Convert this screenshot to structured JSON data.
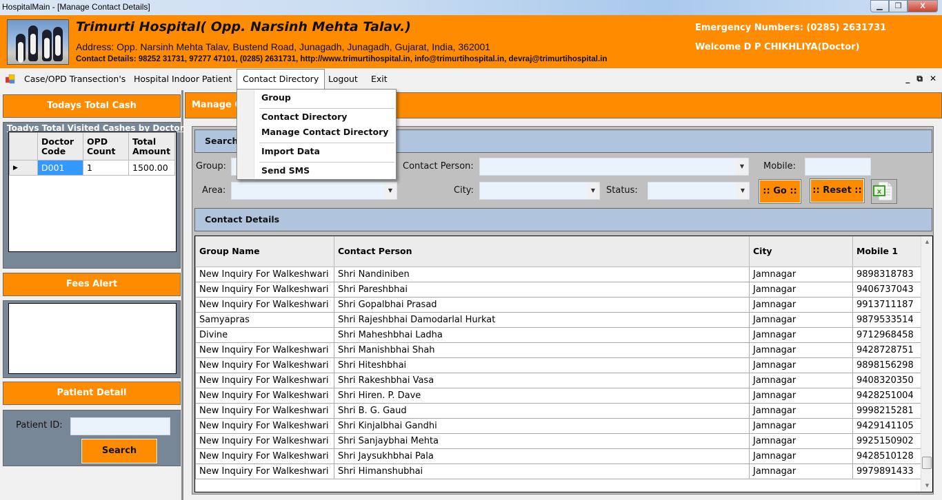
{
  "window": {
    "title": "HospitalMain - [Manage Contact Details]",
    "controls": {
      "minimize": "–",
      "restore": "❐",
      "close": "X"
    }
  },
  "header": {
    "hospital_name": "Trimurti Hospital( Opp. Narsinh Mehta Talav.)",
    "address": "Address: Opp. Narsinh Mehta Talav, Bustend Road, Junagadh, Junagadh, Gujarat, India, 362001",
    "contact_details": "Contact Details: 98252 31731, 97277 47101, (0285) 2631731, http://www.trimurtihospital.in, info@trimurtihospital.in, devraj@trimurtihospital.in",
    "emergency": "Emergency Numbers: (0285) 2631731",
    "welcome": "Welcome D P CHIKHLIYA(Doctor)"
  },
  "menubar": {
    "items": [
      "Case/OPD Transection's",
      "Hospital Indoor Patient",
      "Contact Directory",
      "Logout",
      "Exit"
    ],
    "active": "Contact Directory",
    "mdi_controls": {
      "minimize": "_",
      "restore": "🗗",
      "close": "✕"
    }
  },
  "contact_menu": {
    "items": [
      "Group",
      "Contact Directory",
      "Manage Contact Directory",
      "Import Data",
      "Send SMS"
    ]
  },
  "left": {
    "cash_title": "Todays Total Cash",
    "visited_title": "Toadys Total Visited Cashes by Doctors",
    "cash_grid": {
      "headers": [
        [
          "Doctor",
          "Code"
        ],
        [
          "OPD",
          "Count"
        ],
        [
          "Total",
          "Amount"
        ]
      ],
      "rows": [
        [
          "D001",
          "1",
          "1500.00"
        ]
      ]
    },
    "fees_title": "Fees Alert",
    "patient_title": "Patient Detail",
    "patient_id_label": "Patient ID:",
    "patient_id_value": "",
    "search_label": "Search"
  },
  "main": {
    "title": "Manage Contact Details",
    "search_band": "Search...",
    "filters": {
      "group_label": "Group:",
      "contact_person_label": "Contact Person:",
      "mobile_label": "Mobile:",
      "area_label": "Area:",
      "city_label": "City:",
      "status_label": "Status:",
      "group_value": "",
      "contact_person_value": "",
      "mobile_value": "",
      "area_value": "",
      "city_value": "",
      "status_value": ""
    },
    "go_label": ":: Go ::",
    "reset_label": ":: Reset ::",
    "details_band": "Contact Details",
    "grid": {
      "headers": [
        "Group Name",
        "Contact Person",
        "City",
        "Mobile 1"
      ],
      "rows": [
        [
          "New Inquiry For Walkeshwari",
          "Shri Nandiniben",
          "Jamnagar",
          "9898318783"
        ],
        [
          "New Inquiry For Walkeshwari",
          "Shri Pareshbhai",
          "Jamnagar",
          "9406737043"
        ],
        [
          "New Inquiry For Walkeshwari",
          "Shri Gopalbhai Prasad",
          "Jamnagar",
          "9913711187"
        ],
        [
          "Samyapras",
          "Shri Rajeshbhai Damodarlal Hurkat",
          "Jamnagar",
          "9879533514"
        ],
        [
          "Divine",
          "Shri Maheshbhai Ladha",
          "Jamnagar",
          "9712968458"
        ],
        [
          "New Inquiry For Walkeshwari",
          "Shri Manishbhai Shah",
          "Jamnagar",
          "9428728751"
        ],
        [
          "New Inquiry For Walkeshwari",
          "Shri Hiteshbhai",
          "Jamnagar",
          "9898156298"
        ],
        [
          "New Inquiry For Walkeshwari",
          "Shri Rakeshbhai Vasa",
          "Jamnagar",
          "9408320350"
        ],
        [
          "New Inquiry For Walkeshwari",
          "Shri Hiren. P. Dave",
          "Jamnagar",
          "9428251004"
        ],
        [
          "New Inquiry For Walkeshwari",
          "Shri B. G. Gaud",
          "Jamnagar",
          "9998215281"
        ],
        [
          "New Inquiry For Walkeshwari",
          "Shri Kinjalbhai Gandhi",
          "Jamnagar",
          "9429141105"
        ],
        [
          "New Inquiry For Walkeshwari",
          "Shri Sanjaybhai Mehta",
          "Jamnagar",
          "9925150902"
        ],
        [
          "New Inquiry For Walkeshwari",
          "Shri Jaysukhbhai Pala",
          "Jamnagar",
          "9428510128"
        ],
        [
          "New Inquiry For Walkeshwari",
          "Shri Himanshubhai",
          "Jamnagar",
          "9979891433"
        ]
      ],
      "scroll_position": 0.95
    }
  },
  "colors": {
    "brand_orange": "#ff8c00",
    "band_blue": "#b0c4de",
    "slate": "#788797",
    "selected_cell": "#3399ff"
  }
}
